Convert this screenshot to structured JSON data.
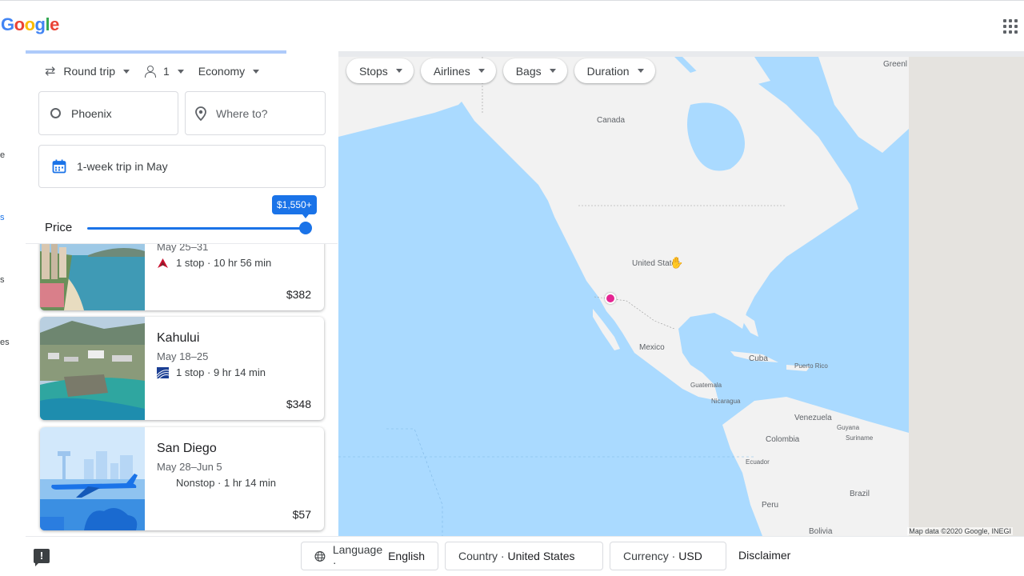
{
  "header": {
    "logo_letters": [
      {
        "ch": "G",
        "color": "#4285f4"
      },
      {
        "ch": "o",
        "color": "#ea4335"
      },
      {
        "ch": "o",
        "color": "#fbbc05"
      },
      {
        "ch": "g",
        "color": "#4285f4"
      },
      {
        "ch": "l",
        "color": "#34a853"
      },
      {
        "ch": "e",
        "color": "#ea4335"
      }
    ],
    "apps_icon": "apps-grid-icon"
  },
  "nav_fragments": [
    "e",
    "s",
    "s",
    "es"
  ],
  "search": {
    "trip_type": "Round trip",
    "passengers": "1",
    "cabin": "Economy",
    "origin": "Phoenix",
    "destination_placeholder": "Where to?",
    "dates": "1-week trip in May",
    "price_label": "Price",
    "price_max": "$1,550+",
    "price_slider_fraction": 1.0
  },
  "results": [
    {
      "city": "",
      "dates": "May 25–31",
      "stops": "1 stop · 10 hr 56 min",
      "price": "$382",
      "airline": "delta"
    },
    {
      "city": "Kahului",
      "dates": "May 18–25",
      "stops": "1 stop · 9 hr 14 min",
      "price": "$348",
      "airline": "united"
    },
    {
      "city": "San Diego",
      "dates": "May 28–Jun 5",
      "stops": "Nonstop · 1 hr 14 min",
      "price": "$57",
      "airline": "none"
    }
  ],
  "filters": {
    "stops": "Stops",
    "airlines": "Airlines",
    "bags": "Bags",
    "duration": "Duration"
  },
  "map": {
    "labels": {
      "canada": "Canada",
      "united_states": "United States",
      "mexico": "Mexico",
      "cuba": "Cuba",
      "puerto_rico": "Puerto Rico",
      "guatemala": "Guatemala",
      "nicaragua": "Nicaragua",
      "venezuela": "Venezuela",
      "guyana": "Guyana",
      "suriname": "Suriname",
      "colombia": "Colombia",
      "ecuador": "Ecuador",
      "brazil": "Brazil",
      "peru": "Peru",
      "bolivia": "Bolivia",
      "greenland": "Greenl"
    },
    "credit": "Map data ©2020 Google, INEGI",
    "water_color": "#aadaff",
    "land_color": "#f2f2f2",
    "pin_color": "#e52592"
  },
  "footer": {
    "language_label": "Language · ",
    "language_value": "English",
    "country_label": "Country · ",
    "country_value": "United States",
    "currency_label": "Currency · ",
    "currency_value": "USD",
    "disclaimer": "Disclaimer"
  },
  "colors": {
    "accent": "#1a73e8"
  }
}
